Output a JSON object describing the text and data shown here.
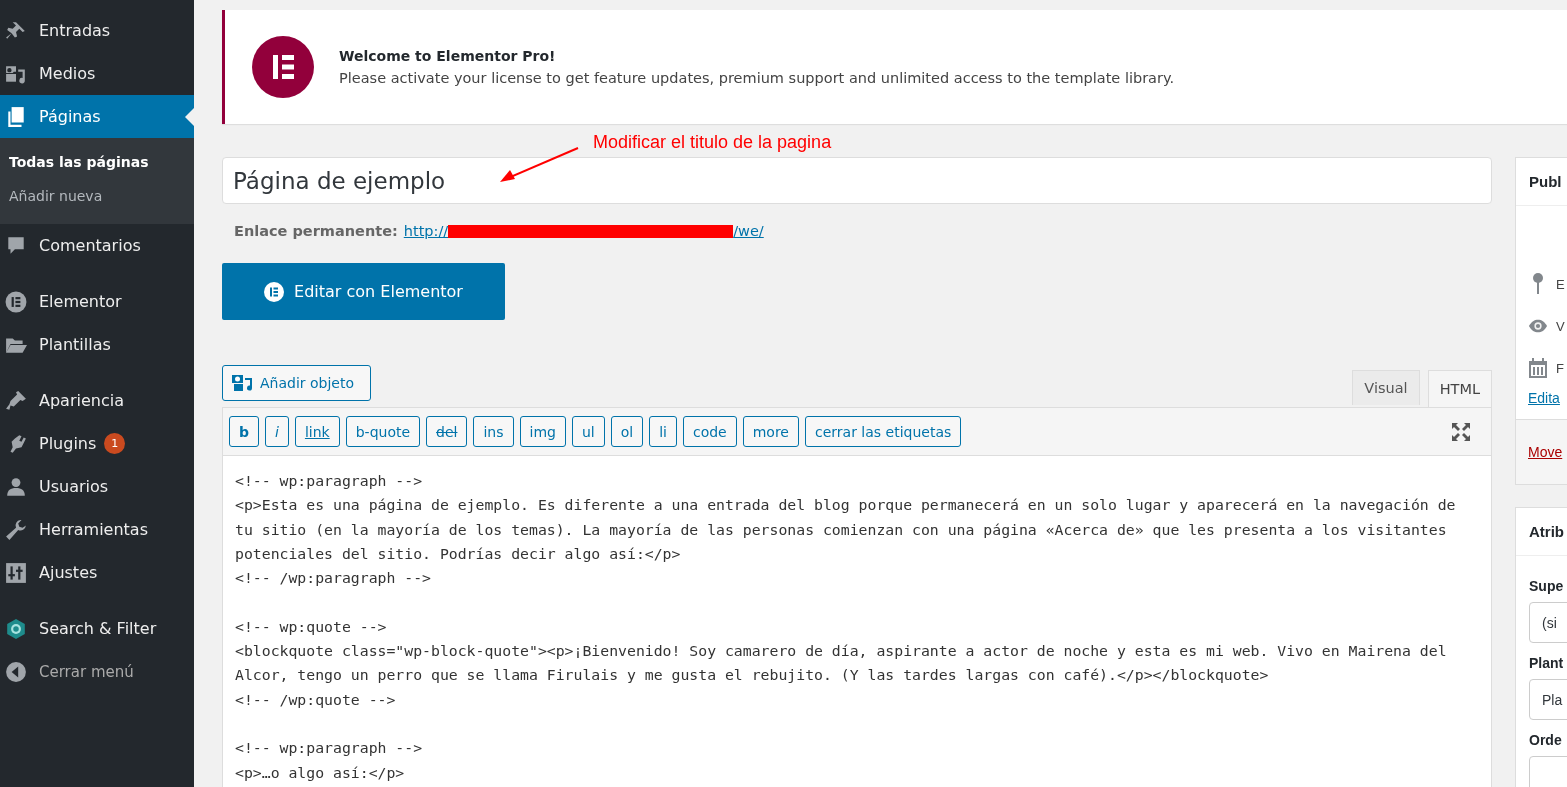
{
  "sidebar": {
    "groups": [
      {
        "items": [
          {
            "label": "Entradas",
            "selected": false
          },
          {
            "label": "Medios",
            "selected": false
          },
          {
            "label": "Páginas",
            "selected": true,
            "submenu": [
              {
                "label": "Todas las páginas",
                "selected": true
              },
              {
                "label": "Añadir nueva",
                "selected": false
              }
            ]
          },
          {
            "label": "Comentarios",
            "selected": false
          }
        ]
      },
      {
        "items": [
          {
            "label": "Elementor",
            "selected": false
          },
          {
            "label": "Plantillas",
            "selected": false
          }
        ]
      },
      {
        "items": [
          {
            "label": "Apariencia",
            "selected": false
          },
          {
            "label": "Plugins",
            "selected": false,
            "badge": "1"
          },
          {
            "label": "Usuarios",
            "selected": false
          },
          {
            "label": "Herramientas",
            "selected": false
          },
          {
            "label": "Ajustes",
            "selected": false
          }
        ]
      },
      {
        "items": [
          {
            "label": "Search & Filter",
            "selected": false
          }
        ]
      }
    ],
    "collapse": "Cerrar menú"
  },
  "notice": {
    "title": "Welcome to Elementor Pro!",
    "message": "Please activate your license to get feature updates, premium support and unlimited access to the template library."
  },
  "annotation": {
    "text": "Modificar el titulo de la pagina"
  },
  "title_field": {
    "value": "Página de ejemplo"
  },
  "permalink": {
    "label": "Enlace permanente:",
    "link_start": "http://",
    "link_end": "/we/",
    "redacted": true
  },
  "elementor_button": "Editar con Elementor",
  "add_media_button": "Añadir objeto",
  "editor_tabs": [
    {
      "label": "Visual",
      "selected": false
    },
    {
      "label": "HTML",
      "selected": true
    }
  ],
  "quicktags": [
    {
      "label": "b",
      "kind": "bold"
    },
    {
      "label": "i",
      "kind": "italic"
    },
    {
      "label": "link",
      "kind": "underline"
    },
    {
      "label": "b-quote",
      "kind": "plain"
    },
    {
      "label": "del",
      "kind": "strike"
    },
    {
      "label": "ins",
      "kind": "plain"
    },
    {
      "label": "img",
      "kind": "plain"
    },
    {
      "label": "ul",
      "kind": "plain"
    },
    {
      "label": "ol",
      "kind": "plain"
    },
    {
      "label": "li",
      "kind": "plain"
    },
    {
      "label": "code",
      "kind": "plain"
    },
    {
      "label": "more",
      "kind": "plain"
    },
    {
      "label": "cerrar las etiquetas",
      "kind": "plain"
    }
  ],
  "code_blocks": [
    [
      "<!-- wp:paragraph -->",
      "<p>Esta es una página de ejemplo. Es diferente a una entrada del blog porque permanecerá en un solo lugar y aparecerá en la navegación de tu sitio (en la mayoría de los temas). La mayoría de las personas comienzan con una página «Acerca de» que les presenta a los visitantes potenciales del sitio. Podrías decir algo así:</p>",
      "<!-- /wp:paragraph -->"
    ],
    [
      "<!-- wp:quote -->",
      "<blockquote class=\"wp-block-quote\"><p>¡Bienvenido! Soy camarero de día, aspirante a actor de noche y esta es mi web. Vivo en Mairena del Alcor, tengo un perro que se llama Firulais y me gusta el rebujito. (Y las tardes largas con café).</p></blockquote>",
      "<!-- /wp:quote -->"
    ],
    [
      "<!-- wp:paragraph -->",
      "<p>…o algo así:</p>"
    ]
  ],
  "publish_box": {
    "title": "Publ",
    "rows": [
      {
        "kind": "pin",
        "text": "E"
      },
      {
        "kind": "eye",
        "text": "V"
      },
      {
        "kind": "calendar",
        "text": "F"
      }
    ],
    "edit_link": "Edita",
    "trash_link": "Move"
  },
  "attributes_box": {
    "title": "Atrib",
    "fields": [
      {
        "label": "Supe",
        "value": "(si"
      },
      {
        "label": "Plant",
        "value": "Pla"
      },
      {
        "label": "Orde"
      }
    ]
  }
}
